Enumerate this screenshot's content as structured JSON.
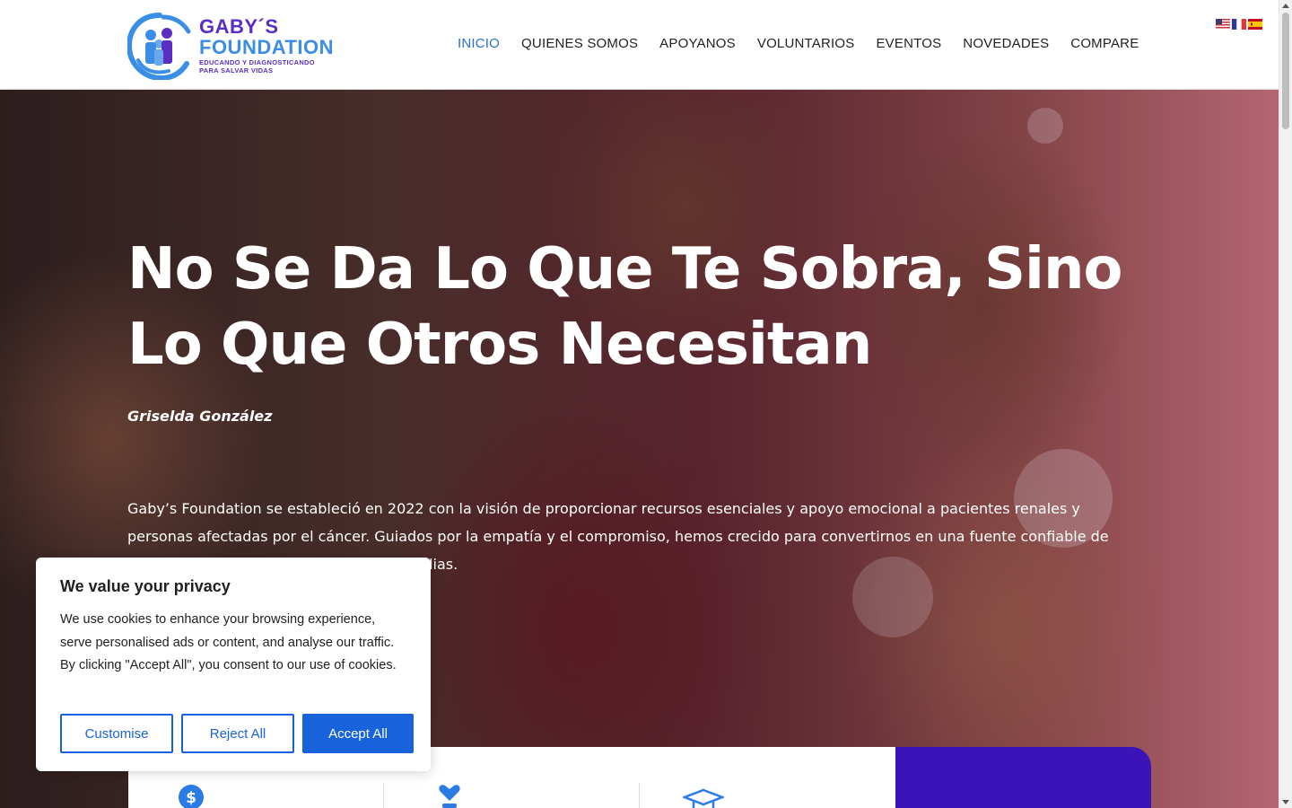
{
  "brand": {
    "name_line1": "GABY´S",
    "name_line2": "FOUNDATION",
    "tagline_line1": "EDUCANDO Y DIAGNOSTICANDO",
    "tagline_line2": "PARA SALVAR VIDAS",
    "primary_color": "#5a2ec4",
    "secondary_color": "#3a8ee6"
  },
  "nav": {
    "items": [
      {
        "label": "INICIO",
        "active": true
      },
      {
        "label": "QUIENES SOMOS",
        "active": false
      },
      {
        "label": "APOYANOS",
        "active": false
      },
      {
        "label": "VOLUNTARIOS",
        "active": false
      },
      {
        "label": "EVENTOS",
        "active": false
      },
      {
        "label": "NOVEDADES",
        "active": false
      },
      {
        "label": "COMPARE",
        "active": false
      }
    ],
    "active_color": "#2a6fcf"
  },
  "languages": [
    {
      "icon": "flag-us-icon"
    },
    {
      "icon": "flag-fr-icon"
    },
    {
      "icon": "flag-es-icon"
    }
  ],
  "hero": {
    "title": "No Se Da Lo Que Te Sobra, Sino Lo Que Otros Necesitan",
    "author": "Griselda González",
    "description": "Gaby’s Foundation se estableció en 2022 con la visión de proporcionar recursos esenciales y apoyo emocional a pacientes renales y personas afectadas por el cáncer. Guiados por la empatía y el compromiso, hemos crecido para convertirnos en una fuente confiable de apoyo para diversos individuos y sus familias."
  },
  "feature_cards": [
    {
      "icon": "dollar-hand-icon"
    },
    {
      "icon": "heart-hand-icon"
    },
    {
      "icon": "graduation-cap-icon"
    }
  ],
  "cookie_banner": {
    "title": "We value your privacy",
    "text": "We use cookies to enhance your browsing experience, serve personalised ads or content, and analyse our traffic. By clicking \"Accept All\", you consent to our use of cookies.",
    "customise_label": "Customise",
    "reject_label": "Reject All",
    "accept_label": "Accept All",
    "button_color": "#1863dc"
  },
  "accent_panel_color": "#3a14b8"
}
